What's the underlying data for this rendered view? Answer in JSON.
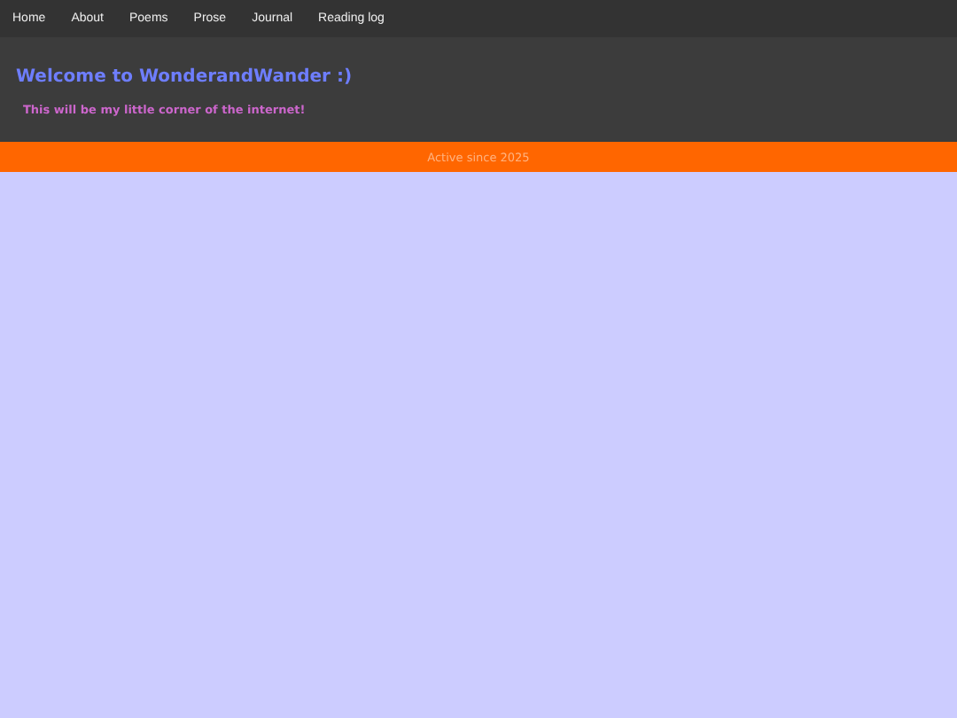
{
  "nav": {
    "items": [
      {
        "label": "Home"
      },
      {
        "label": "About"
      },
      {
        "label": "Poems"
      },
      {
        "label": "Prose"
      },
      {
        "label": "Journal"
      },
      {
        "label": "Reading log"
      }
    ]
  },
  "header": {
    "title": "Welcome to WonderandWander :)",
    "subtitle": "This will be my little corner of the internet!"
  },
  "banner": {
    "text": "Active since 2025"
  }
}
